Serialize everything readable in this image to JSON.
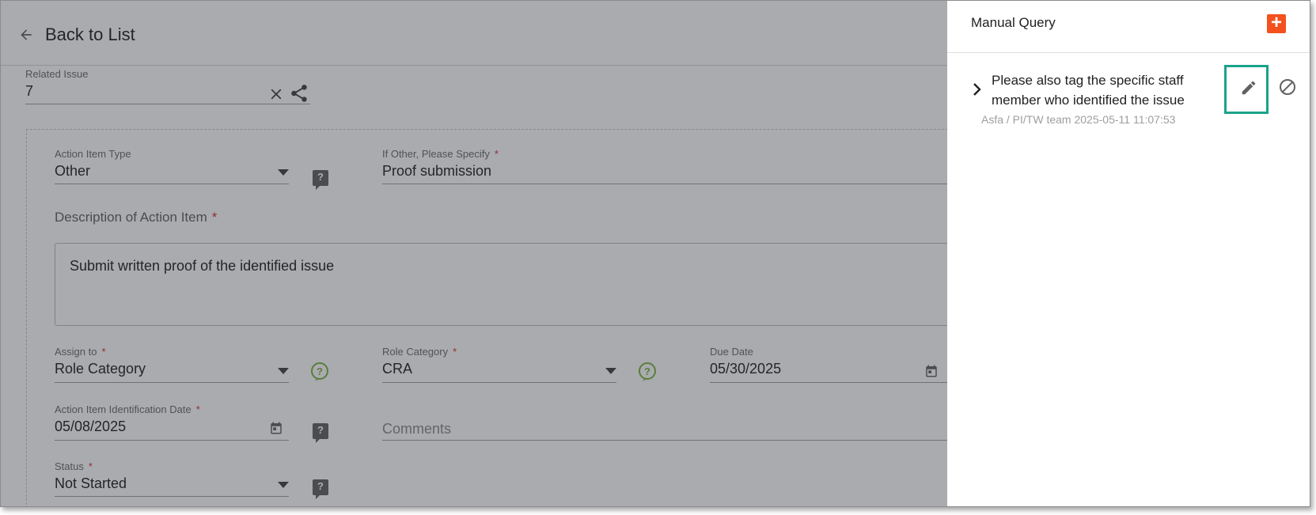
{
  "header": {
    "back_label": "Back to List"
  },
  "form": {
    "related_issue": {
      "label": "Related Issue",
      "value": "7"
    },
    "action_item_type": {
      "label": "Action Item Type",
      "value": "Other"
    },
    "if_other": {
      "label": "If Other, Please Specify",
      "required_mark": "*",
      "value": "Proof submission"
    },
    "description": {
      "label": "Description of Action Item",
      "required_mark": "*",
      "value": "Submit written proof of the identified issue"
    },
    "assign_to": {
      "label": "Assign to",
      "required_mark": "*",
      "value": "Role Category"
    },
    "role_category": {
      "label": "Role Category",
      "required_mark": "*",
      "value": "CRA"
    },
    "due_date": {
      "label": "Due Date",
      "value": "05/30/2025"
    },
    "identification_date": {
      "label": "Action Item Identification Date",
      "required_mark": "*",
      "value": "05/08/2025"
    },
    "comments": {
      "placeholder": "Comments"
    },
    "status": {
      "label": "Status",
      "required_mark": "*",
      "value": "Not Started"
    }
  },
  "panel": {
    "title": "Manual Query",
    "add_label": "+",
    "query": {
      "text": "Please also tag the specific staff member who identified the issue",
      "author": "Asfa",
      "team": "/ PI/TW team",
      "timestamp": "2025-05-11 11:07:53"
    }
  },
  "colors": {
    "accent_orange": "#f4511e",
    "highlight_teal": "#1aa38a",
    "help_green": "#7cb342",
    "required_red": "#d32f2f"
  }
}
